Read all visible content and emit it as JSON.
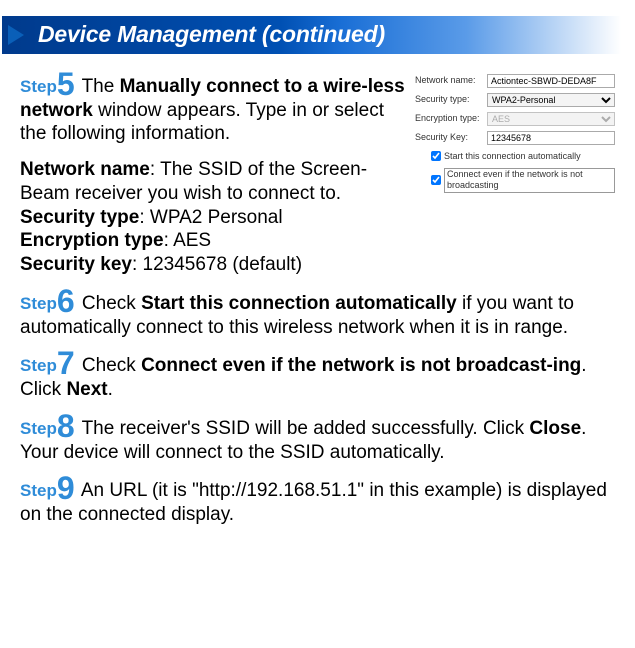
{
  "header": {
    "title": "Device Management (continued)"
  },
  "steps": {
    "s5": {
      "label": "Step",
      "num": "5",
      "prefix": " The ",
      "bold1": "Manually connect to a wire-less network",
      "rest": " window appears. Type in or select the following information."
    },
    "params": {
      "nn_label": "Network name",
      "nn_text": ": The SSID of the Screen-Beam receiver you wish to connect to.",
      "st_label": "Security type",
      "st_text": ": WPA2 Personal",
      "et_label": "Encryption type",
      "et_text": ": AES",
      "sk_label": "Security key",
      "sk_text": ": 12345678 (default)"
    },
    "s6": {
      "label": "Step",
      "num": "6",
      "prefix": " Check ",
      "bold1": "Start this connection automatically",
      "rest": " if you want to automatically connect to this wireless network when it is in range."
    },
    "s7": {
      "label": "Step",
      "num": "7",
      "prefix": " Check ",
      "bold1": "Connect even if the network is not broadcast-ing",
      "mid": ". Click ",
      "bold2": "Next",
      "end": "."
    },
    "s8": {
      "label": "Step",
      "num": "8",
      "prefix": " The receiver's SSID will be added successfully. Click ",
      "bold1": "Close",
      "rest": ". Your device will connect to the SSID automatically."
    },
    "s9": {
      "label": "Step",
      "num": "9",
      "text": " An URL (it is \"http://192.168.51.1\" in this example) is displayed on the connected display."
    }
  },
  "figure": {
    "network_name": {
      "label": "Network name:",
      "value": "Actiontec-SBWD-DEDA8F"
    },
    "security_type": {
      "label": "Security type:",
      "value": "WPA2-Personal"
    },
    "encryption_type": {
      "label": "Encryption type:",
      "value": "AES"
    },
    "security_key": {
      "label": "Security Key:",
      "value": "12345678"
    },
    "check1": "Start this connection automatically",
    "check2": "Connect even if the network is not broadcasting"
  }
}
